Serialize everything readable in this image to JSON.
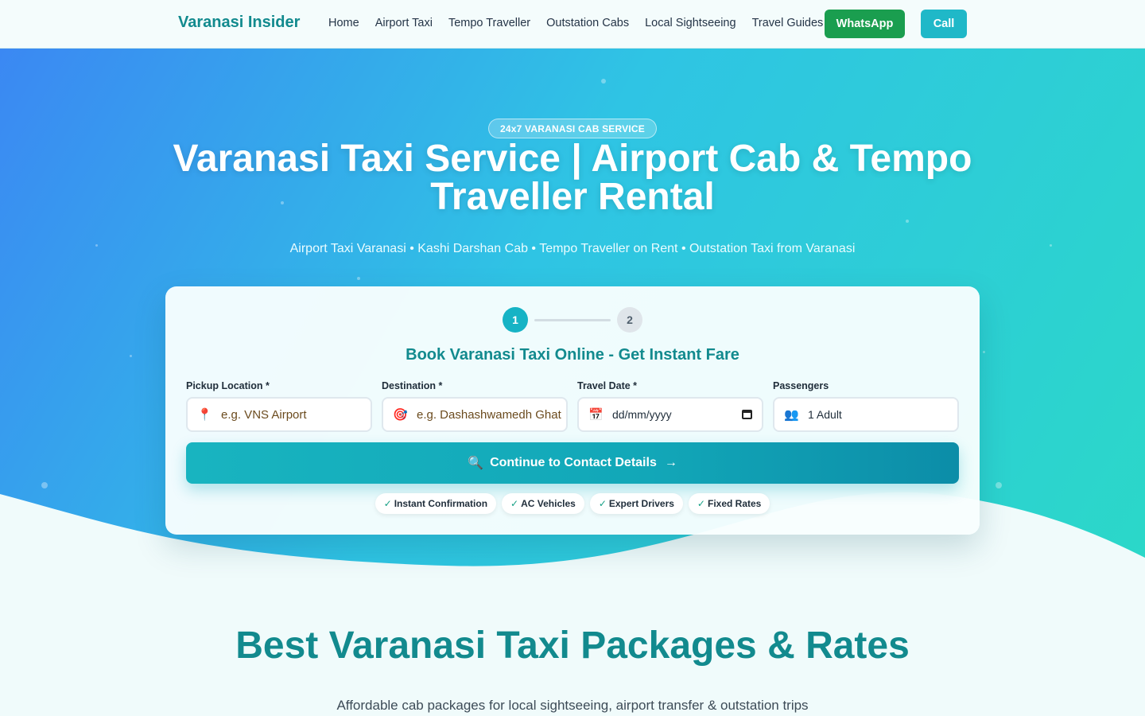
{
  "nav": {
    "brand": "Varanasi Insider",
    "links": [
      "Home",
      "Airport Taxi",
      "Tempo Traveller",
      "Outstation Cabs",
      "Local Sightseeing",
      "Travel Guides"
    ],
    "whatsapp_label": "WhatsApp",
    "call_label": "Call"
  },
  "hero": {
    "badge": "24x7 VARANASI CAB SERVICE",
    "title": "Varanasi Taxi Service | Airport Cab & Tempo Traveller Rental",
    "subtitle": "Airport Taxi Varanasi • Kashi Darshan Cab • Tempo Traveller on Rent • Outstation Taxi from Varanasi"
  },
  "booking": {
    "steps": [
      "1",
      "2"
    ],
    "active_step": 1,
    "title": "Book Varanasi Taxi Online - Get Instant Fare",
    "fields": {
      "pickup": {
        "label": "Pickup Location *",
        "placeholder": "e.g. VNS Airport",
        "icon": "map-pin-icon"
      },
      "destination": {
        "label": "Destination *",
        "placeholder": "e.g. Dashashwamedh Ghat",
        "icon": "target-icon"
      },
      "date": {
        "label": "Travel Date *",
        "placeholder": "dd/mm/yyyy",
        "icon": "calendar-icon"
      },
      "passengers": {
        "label": "Passengers",
        "value": "1 Adult",
        "icon": "people-icon"
      }
    },
    "cta_label": "Continue to Contact Details",
    "features": [
      "Instant Confirmation",
      "AC Vehicles",
      "Expert Drivers",
      "Fixed Rates"
    ]
  },
  "packages": {
    "title": "Best Varanasi Taxi Packages & Rates",
    "subtitle": "Affordable cab packages for local sightseeing, airport transfer & outstation trips"
  },
  "colors": {
    "brand_teal": "#128a8e",
    "whatsapp_green": "#1a9e4f",
    "call_cyan": "#1fb8c8",
    "hero_start": "#3b88f3",
    "hero_end": "#2bd8c8"
  }
}
